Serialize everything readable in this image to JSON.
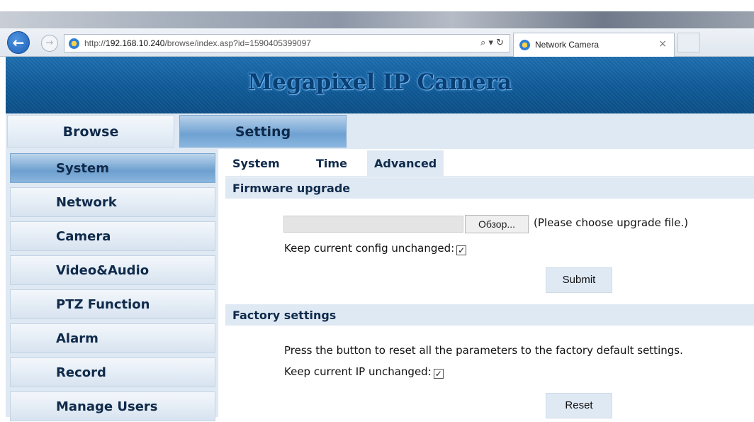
{
  "browser": {
    "url_prefix": "http://",
    "url_host": "192.168.10.240",
    "url_path": "/browse/index.asp?id=1590405399097",
    "tab_title": "Network Camera",
    "tab_close": "×",
    "search_glyph": "⌕ ▾ ↻"
  },
  "header": {
    "title": "Megapixel IP Camera"
  },
  "top_nav": {
    "browse": "Browse",
    "setting": "Setting"
  },
  "sidebar": {
    "items": [
      {
        "label": "System",
        "active": true
      },
      {
        "label": "Network"
      },
      {
        "label": "Camera"
      },
      {
        "label": "Video&Audio"
      },
      {
        "label": "PTZ Function"
      },
      {
        "label": "Alarm"
      },
      {
        "label": "Record"
      },
      {
        "label": "Manage Users"
      }
    ]
  },
  "sub_tabs": {
    "system": "System",
    "time": "Time",
    "advanced": "Advanced",
    "active": "Advanced"
  },
  "firmware": {
    "header": "Firmware upgrade",
    "file_value": "",
    "browse_label": "Обзор...",
    "hint": "(Please choose upgrade file.)",
    "keep_config_label": "Keep current config unchanged:",
    "keep_config_checked": "✓",
    "submit_label": "Submit"
  },
  "factory": {
    "header": "Factory settings",
    "note": "Press the button to reset all the parameters to the factory default settings.",
    "keep_ip_label": "Keep current IP unchanged:",
    "keep_ip_checked": "✓",
    "reset_label": "Reset"
  },
  "colors": {
    "banner": "#0f5a98",
    "nav_bg": "#dfe9f4",
    "active_tab": "#6ea1d1"
  }
}
